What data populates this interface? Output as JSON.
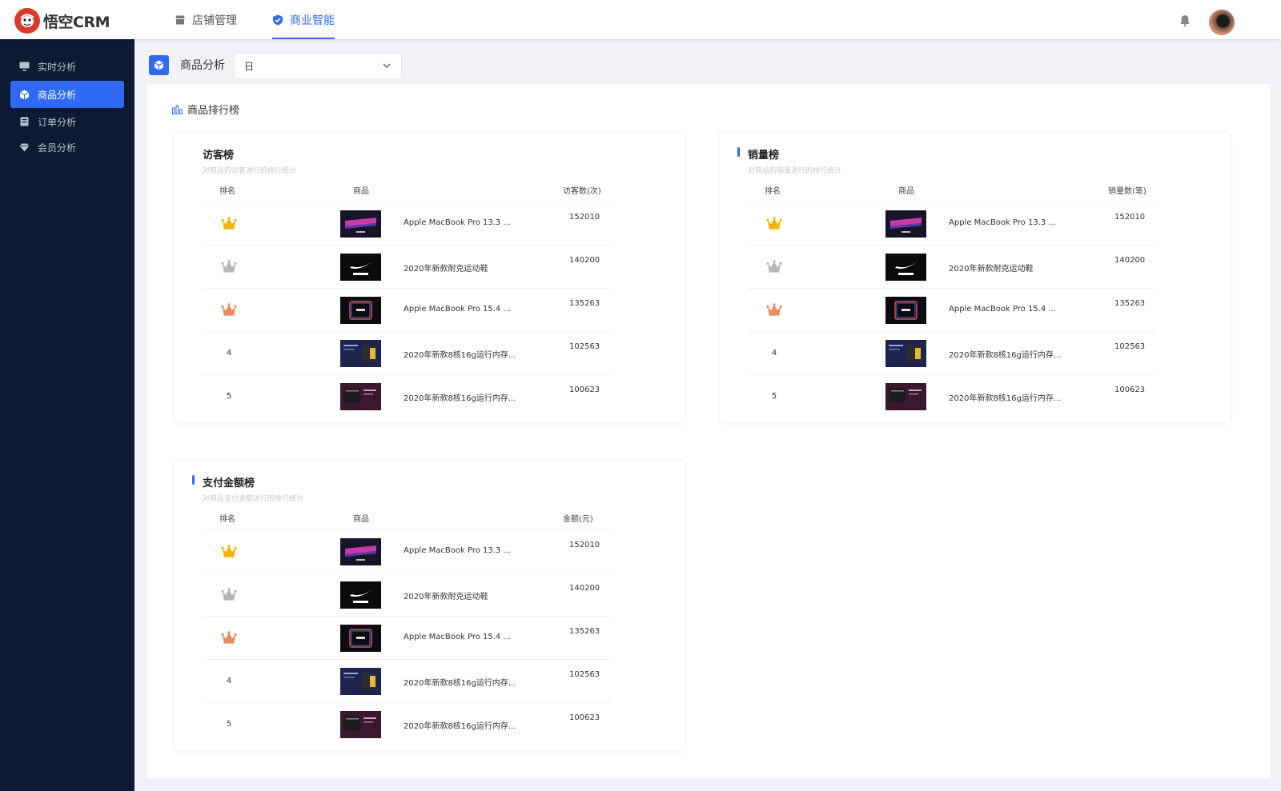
{
  "app": {
    "logo_text": "悟空CRM"
  },
  "top_nav": [
    {
      "label": "店铺管理",
      "icon": "shop-icon",
      "active": false
    },
    {
      "label": "商业智能",
      "icon": "shield-check-icon",
      "active": true
    }
  ],
  "sidebar": {
    "items": [
      {
        "label": "实时分析",
        "icon": "monitor-icon",
        "active": false
      },
      {
        "label": "商品分析",
        "icon": "cube-icon",
        "active": true
      },
      {
        "label": "订单分析",
        "icon": "list-icon",
        "active": false
      },
      {
        "label": "会员分析",
        "icon": "diamond-icon",
        "active": false
      }
    ]
  },
  "page": {
    "title": "商品分析",
    "period_select": {
      "value": "日"
    },
    "section_title": "商品排行榜"
  },
  "colors": {
    "accent": "#2f6bf2",
    "sidebar_bg": "#0c1a33",
    "gold": "#f5b400",
    "silver": "#b5b5b5",
    "bronze": "#e98b5f"
  },
  "cards": [
    {
      "title": "访客榜",
      "subtitle": "对商品的访客进行的排行统计",
      "headers": {
        "rank": "排名",
        "goods": "商品",
        "count": "访客数(次)"
      },
      "rows": [
        {
          "rank": "1",
          "name": "Apple MacBook Pro 13.3 ...",
          "value": "152010",
          "thumb": "macbook-13"
        },
        {
          "rank": "2",
          "name": "2020年新款耐克运动鞋",
          "value": "140200",
          "thumb": "nike"
        },
        {
          "rank": "3",
          "name": "Apple MacBook Pro 15.4 ...",
          "value": "135263",
          "thumb": "macbook-m1"
        },
        {
          "rank": "4",
          "name": "2020年新款8核16g运行内存...",
          "value": "102563",
          "thumb": "laptop-blue"
        },
        {
          "rank": "5",
          "name": "2020年新款8核16g运行内存...",
          "value": "100623",
          "thumb": "laptop-purple"
        }
      ]
    },
    {
      "title": "销量榜",
      "subtitle": "对商品的销量进行的排行统计",
      "headers": {
        "rank": "排名",
        "goods": "商品",
        "count": "销量数(笔)"
      },
      "rows": [
        {
          "rank": "1",
          "name": "Apple MacBook Pro 13.3 ...",
          "value": "152010",
          "thumb": "macbook-13"
        },
        {
          "rank": "2",
          "name": "2020年新款耐克运动鞋",
          "value": "140200",
          "thumb": "nike"
        },
        {
          "rank": "3",
          "name": "Apple MacBook Pro 15.4 ...",
          "value": "135263",
          "thumb": "macbook-m1"
        },
        {
          "rank": "4",
          "name": "2020年新款8核16g运行内存...",
          "value": "102563",
          "thumb": "laptop-blue"
        },
        {
          "rank": "5",
          "name": "2020年新款8核16g运行内存...",
          "value": "100623",
          "thumb": "laptop-purple"
        }
      ]
    },
    {
      "title": "支付金额榜",
      "subtitle": "对商品支付金额进行的排行统计",
      "headers": {
        "rank": "排名",
        "goods": "商品",
        "count": "金额(元)"
      },
      "rows": [
        {
          "rank": "1",
          "name": "Apple MacBook Pro 13.3 ...",
          "value": "152010",
          "thumb": "macbook-13"
        },
        {
          "rank": "2",
          "name": "2020年新款耐克运动鞋",
          "value": "140200",
          "thumb": "nike"
        },
        {
          "rank": "3",
          "name": "Apple MacBook Pro 15.4 ...",
          "value": "135263",
          "thumb": "macbook-m1"
        },
        {
          "rank": "4",
          "name": "2020年新款8核16g运行内存...",
          "value": "102563",
          "thumb": "laptop-blue"
        },
        {
          "rank": "5",
          "name": "2020年新款8核16g运行内存...",
          "value": "100623",
          "thumb": "laptop-purple"
        }
      ]
    }
  ]
}
